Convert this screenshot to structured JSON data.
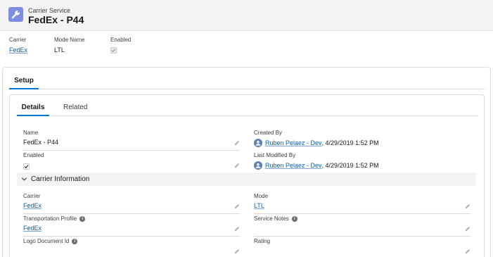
{
  "header": {
    "object_type": "Carrier Service",
    "title": "FedEx - P44"
  },
  "highlights": [
    {
      "label": "Carrier",
      "value": "FedEx"
    },
    {
      "label": "Mode Name",
      "value": "LTL"
    },
    {
      "label": "Enabled",
      "checked": true
    }
  ],
  "tabs": {
    "outer": [
      "Setup"
    ],
    "inner": [
      "Details",
      "Related"
    ]
  },
  "fields": {
    "name": {
      "label": "Name",
      "value": "FedEx - P44"
    },
    "created_by": {
      "label": "Created By",
      "user": "Ruben Pelaez - Dev",
      "date": ", 4/29/2019 1:52 PM"
    },
    "enabled": {
      "label": "Enabled",
      "checked": true
    },
    "last_modified_by": {
      "label": "Last Modified By",
      "user": "Ruben Pelaez - Dev",
      "date": ", 4/29/2019 1:52 PM"
    }
  },
  "section": {
    "title": "Carrier Information",
    "fields": {
      "carrier": {
        "label": "Carrier",
        "value": "FedEx"
      },
      "mode": {
        "label": "Mode",
        "value": "LTL"
      },
      "transportation_profile": {
        "label": "Transportation Profile",
        "value": "FedEx"
      },
      "service_notes": {
        "label": "Service Notes",
        "value": ""
      },
      "logo_document_id": {
        "label": "Logo Document Id",
        "value": ""
      },
      "rating": {
        "label": "Rating",
        "value": ""
      }
    }
  },
  "colors": {
    "accent": "#0176d3",
    "link": "#0b5cab",
    "object_icon": "#7f8de1"
  },
  "icons": {
    "object": "wrench-icon",
    "edit": "pencil-icon",
    "info": "info-icon",
    "section": "chevron-down-icon"
  }
}
